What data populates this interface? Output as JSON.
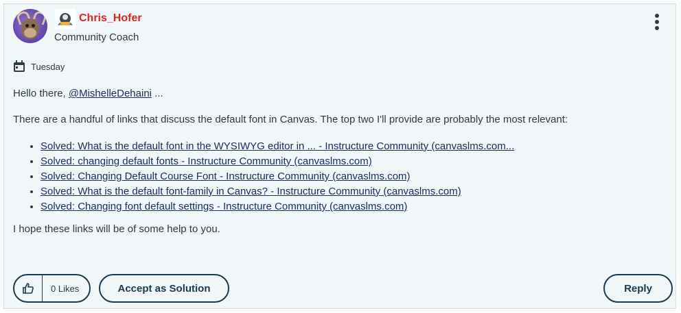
{
  "post": {
    "author": {
      "username": "Chris_Hofer",
      "role": "Community Coach"
    },
    "date": "Tuesday",
    "greeting_prefix": "Hello there, ",
    "mention": "@MishelleDehaini",
    "greeting_suffix": " ...",
    "intro": "There are a handful of links that discuss the default font in Canvas.  The top two I'll provide are probably the most relevant:",
    "links": [
      "Solved: What is the default font in the WYSIWYG editor in ... - Instructure Community (canvaslms.com...",
      "Solved: changing default fonts - Instructure Community (canvaslms.com)",
      "Solved: Changing Default Course Font - Instructure Community (canvaslms.com)",
      "Solved: What is the default font-family in Canvas? - Instructure Community (canvaslms.com)",
      "Solved: Changing font default settings - Instructure Community (canvaslms.com)"
    ],
    "closing": "I hope these links will be of some help to you."
  },
  "actions": {
    "likes_label": "0 Likes",
    "accept_label": "Accept as Solution",
    "reply_label": "Reply"
  },
  "colors": {
    "username": "#e0261b",
    "card_background": "#f1f6f9",
    "link": "#1b2e60",
    "button_border": "#1b3a4b"
  },
  "icons": [
    "avatar-reindeer",
    "rank-badge-icon",
    "more-options-icon",
    "calendar-icon",
    "thumbs-up-icon"
  ]
}
